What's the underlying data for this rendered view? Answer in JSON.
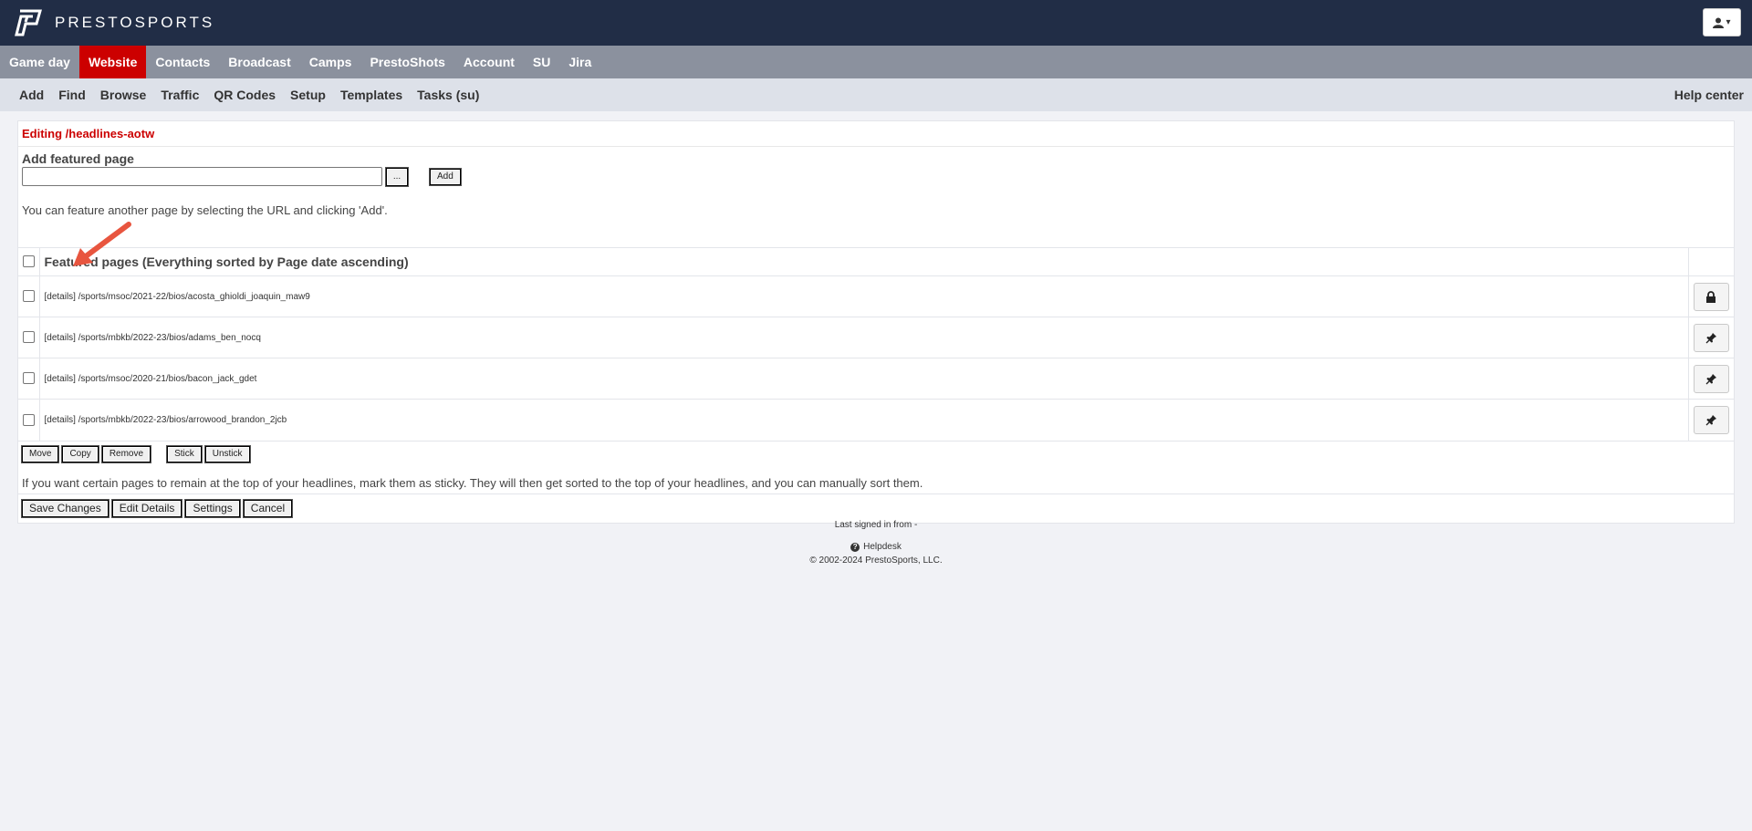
{
  "header": {
    "brand": "PRESTOSPORTS"
  },
  "main_nav": [
    {
      "label": "Game day",
      "active": false
    },
    {
      "label": "Website",
      "active": true
    },
    {
      "label": "Contacts",
      "active": false
    },
    {
      "label": "Broadcast",
      "active": false
    },
    {
      "label": "Camps",
      "active": false
    },
    {
      "label": "PrestoShots",
      "active": false
    },
    {
      "label": "Account",
      "active": false
    },
    {
      "label": "SU",
      "active": false
    },
    {
      "label": "Jira",
      "active": false
    }
  ],
  "sub_nav": [
    "Add",
    "Find",
    "Browse",
    "Traffic",
    "QR Codes",
    "Setup",
    "Templates",
    "Tasks (su)"
  ],
  "help_center": "Help center",
  "panel": {
    "title": "Editing /headlines-aotw",
    "add_label": "Add featured page",
    "url_value": "",
    "browse_label": "...",
    "add_button": "Add",
    "help_text": "You can feature another page by selecting the URL and clicking 'Add'.",
    "list_header": "Featured pages (Everything sorted by Page date ascending)",
    "rows": [
      {
        "details": "[details]",
        "path": "/sports/msoc/2021-22/bios/acosta_ghioldi_joaquin_maw9",
        "icon": "lock-icon"
      },
      {
        "details": "[details]",
        "path": "/sports/mbkb/2022-23/bios/adams_ben_nocq",
        "icon": "pin-icon"
      },
      {
        "details": "[details]",
        "path": "/sports/msoc/2020-21/bios/bacon_jack_gdet",
        "icon": "pin-icon"
      },
      {
        "details": "[details]",
        "path": "/sports/mbkb/2022-23/bios/arrowood_brandon_2jcb",
        "icon": "pin-icon"
      }
    ],
    "actions": {
      "move": "Move",
      "copy": "Copy",
      "remove": "Remove",
      "stick": "Stick",
      "unstick": "Unstick"
    },
    "sticky_note": "If you want certain pages to remain at the top of your headlines, mark them as sticky. They will then get sorted to the top of your headlines, and you can manually sort them.",
    "final": {
      "save": "Save Changes",
      "edit": "Edit Details",
      "settings": "Settings",
      "cancel": "Cancel"
    }
  },
  "footer": {
    "last_signed": "Last signed in from -",
    "helpdesk": "Helpdesk",
    "copyright": "© 2002-2024 PrestoSports, LLC."
  },
  "colors": {
    "header_bg": "#212d46",
    "nav_bg": "#8b919e",
    "active_tab": "#cc0000",
    "subnav_bg": "#dde1e9",
    "annotation_arrow": "#e8553f"
  }
}
